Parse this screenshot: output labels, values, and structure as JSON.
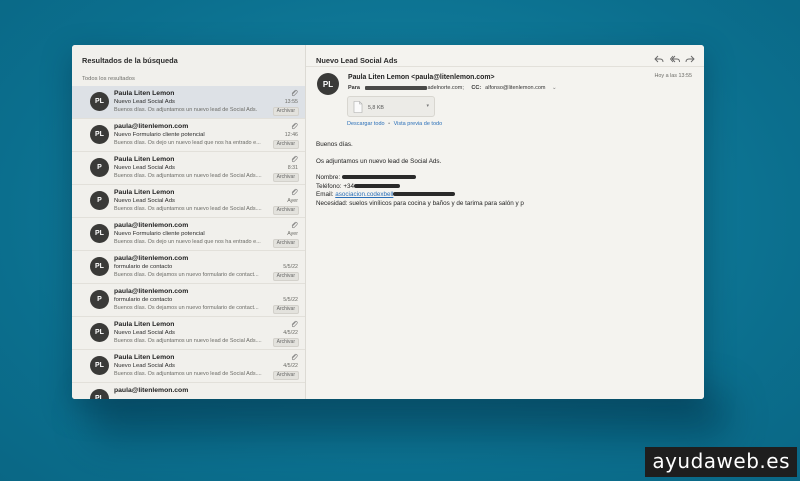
{
  "left_pane": {
    "title": "Resultados de la búsqueda",
    "section_label": "Todos los resultados",
    "messages": [
      {
        "initials": "PL",
        "sender": "Paula Liten Lemon",
        "subject": "Nuevo Lead Social Ads",
        "preview": "Buenos días. Os adjuntamos un nuevo lead de Social Ads.",
        "date": "13:55",
        "attachment": true,
        "badge": "Archivar",
        "selected": true
      },
      {
        "initials": "PL",
        "sender": "paula@litenlemon.com",
        "subject": "Nuevo Formulario cliente potencial",
        "preview": "Buenos días. Os dejo un nuevo lead que nos ha entrado e...",
        "date": "12:46",
        "attachment": true,
        "badge": "Archivar",
        "selected": false
      },
      {
        "initials": "P",
        "sender": "Paula Liten Lemon",
        "subject": "Nuevo Lead Social Ads",
        "preview": "Buenos días. Os adjuntamos un nuevo lead de Social Ads....",
        "date": "8:31",
        "attachment": true,
        "badge": "Archivar",
        "selected": false
      },
      {
        "initials": "P",
        "sender": "Paula Liten Lemon",
        "subject": "Nuevo Lead Social Ads",
        "preview": "Buenos días. Os adjuntamos un nuevo lead de Social Ads....",
        "date": "Ayer",
        "attachment": true,
        "badge": "Archivar",
        "selected": false
      },
      {
        "initials": "PL",
        "sender": "paula@litenlemon.com",
        "subject": "Nuevo Formulario cliente potencial",
        "preview": "Buenos días. Os dejo un nuevo lead que nos ha entrado e...",
        "date": "Ayer",
        "attachment": true,
        "badge": "Archivar",
        "selected": false
      },
      {
        "initials": "PL",
        "sender": "paula@litenlemon.com",
        "subject": "formulario de contacto",
        "preview": "Buenos días. Os dejamos un nuevo formulario de contact...",
        "date": "5/5/22",
        "attachment": false,
        "badge": "Archivar",
        "selected": false
      },
      {
        "initials": "P",
        "sender": "paula@litenlemon.com",
        "subject": "formulario de contacto",
        "preview": "Buenos días. Os dejamos un nuevo formulario de contact...",
        "date": "5/5/22",
        "attachment": false,
        "badge": "Archivar",
        "selected": false
      },
      {
        "initials": "PL",
        "sender": "Paula Liten Lemon",
        "subject": "Nuevo Lead Social Ads",
        "preview": "Buenos días. Os adjuntamos un nuevo lead de Social Ads....",
        "date": "4/5/22",
        "attachment": true,
        "badge": "Archivar",
        "selected": false
      },
      {
        "initials": "PL",
        "sender": "Paula Liten Lemon",
        "subject": "Nuevo Lead Social Ads",
        "preview": "Buenos días. Os adjuntamos un nuevo lead de Social Ads....",
        "date": "4/5/22",
        "attachment": true,
        "badge": "Archivar",
        "selected": false
      },
      {
        "initials": "PL",
        "sender": "paula@litenlemon.com",
        "subject": "",
        "preview": "",
        "date": "",
        "attachment": false,
        "badge": "",
        "selected": false
      }
    ]
  },
  "detail": {
    "title": "Nuevo Lead Social Ads",
    "toolbar": {
      "reply_icon": "reply-icon",
      "reply_all_icon": "reply-all-icon",
      "forward_icon": "forward-icon"
    },
    "avatar_initials": "PL",
    "from": "Paula Liten Lemon <paula@litenlemon.com>",
    "received": "Hoy a las 13:55",
    "to_label": "Para",
    "to_suffix": "adelnorte.com;",
    "cc_label": "CC:",
    "cc_value": "alfonso@litenlemon.com",
    "attachment_size": "5,8 KB",
    "download_all": "Descargar todo",
    "preview_all": "Vista previa de todo",
    "link_separator": "•",
    "body": {
      "greeting": "Buenos días.",
      "intro": "Os adjuntamos un nuevo lead de Social Ads.",
      "name_label": "Nombre:",
      "phone_label": "Teléfono:",
      "phone_prefix": "+34",
      "email_label": "Email:",
      "email_value": "asociacion.codexbell",
      "need_label": "Necesidad:",
      "need_value": "suelos vinílicos para cocina y baños y de tarima para salón y p"
    }
  },
  "watermark": "ayudaweb.es",
  "colors": {
    "background": "#0f7a9a",
    "link": "#2a6fb8",
    "avatar": "#3a3a38",
    "selected_row": "#dde1e6"
  }
}
